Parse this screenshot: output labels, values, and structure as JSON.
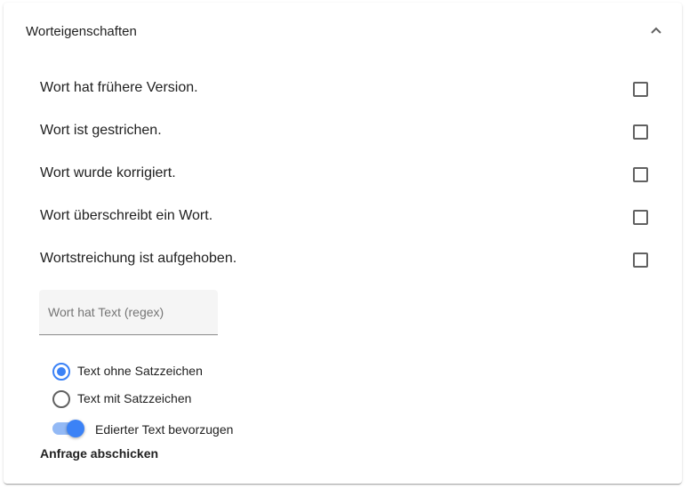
{
  "panel": {
    "title": "Worteigenschaften",
    "collapse_icon": "chevron-up-icon"
  },
  "checkboxes": [
    {
      "label": "Wort hat frühere Version.",
      "checked": false
    },
    {
      "label": "Wort ist gestrichen.",
      "checked": false
    },
    {
      "label": "Wort wurde korrigiert.",
      "checked": false
    },
    {
      "label": "Wort überschreibt ein Wort.",
      "checked": false
    },
    {
      "label": "Wortstreichung ist aufgehoben.",
      "checked": false
    }
  ],
  "regex_field": {
    "placeholder": "Wort hat Text (regex)",
    "value": ""
  },
  "radios": [
    {
      "label": "Text ohne Satzzeichen",
      "checked": true
    },
    {
      "label": "Text mit Satzzeichen",
      "checked": false
    }
  ],
  "toggle": {
    "label": "Edierter Text bevorzugen",
    "on": true
  },
  "submit": {
    "label": "Anfrage abschicken"
  },
  "colors": {
    "accent": "#3b82f6",
    "accent_light": "#93b9f5"
  }
}
